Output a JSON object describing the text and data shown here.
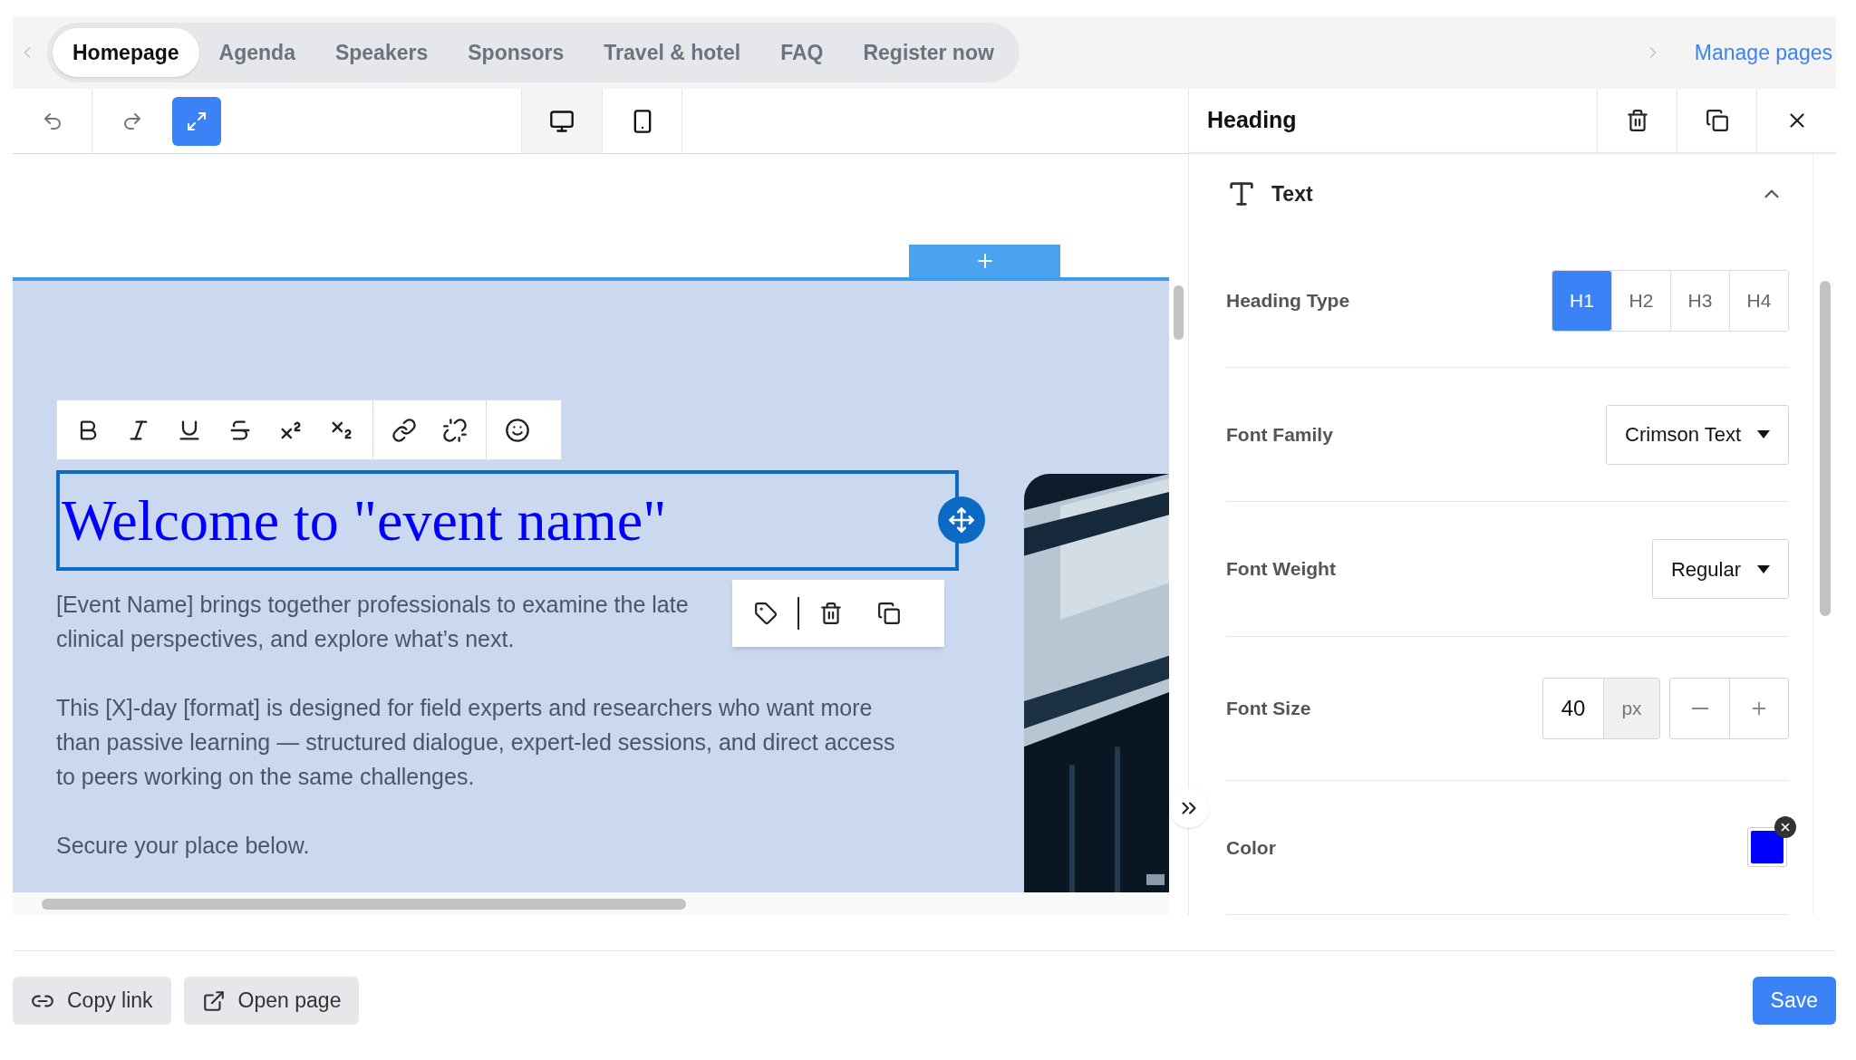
{
  "page_tabs": [
    {
      "label": "Homepage",
      "selected": true
    },
    {
      "label": "Agenda",
      "selected": false
    },
    {
      "label": "Speakers",
      "selected": false
    },
    {
      "label": "Sponsors",
      "selected": false
    },
    {
      "label": "Travel & hotel",
      "selected": false
    },
    {
      "label": "FAQ",
      "selected": false
    },
    {
      "label": "Register now",
      "selected": false
    }
  ],
  "manage_pages": "Manage pages",
  "fullscreen": true,
  "devices": [
    {
      "kind": "desktop",
      "selected": true
    },
    {
      "kind": "mobile",
      "selected": false
    }
  ],
  "heading": "Welcome to \"event name\"",
  "paragraphs": [
    {
      "lines": [
        "[Event Name] brings together professionals to examine the late",
        "clinical perspectives, and explore what’s next."
      ]
    },
    {
      "lines": [
        "This [X]-day [format] is designed for field experts and researchers who want more",
        "than passive learning — structured dialogue, expert-led sessions, and direct access",
        "to peers working on the same challenges."
      ]
    },
    {
      "lines": [
        "Secure your place below."
      ]
    }
  ],
  "panel": {
    "title": "Heading",
    "section": {
      "title": "Text",
      "expanded": true
    },
    "heading_type": {
      "label": "Heading Type",
      "options": [
        {
          "label": "H1",
          "selected": true
        },
        {
          "label": "H2",
          "selected": false
        },
        {
          "label": "H3",
          "selected": false
        },
        {
          "label": "H4",
          "selected": false
        }
      ]
    },
    "font_family": {
      "label": "Font Family",
      "value": "Crimson Text"
    },
    "font_weight": {
      "label": "Font Weight",
      "value": "Regular"
    },
    "font_size": {
      "label": "Font Size",
      "value": "40",
      "unit": "px"
    },
    "color": {
      "label": "Color",
      "color": "#0000ff"
    }
  },
  "footer": {
    "copy_link": "Copy link",
    "open_page": "Open page",
    "save": "Save"
  }
}
